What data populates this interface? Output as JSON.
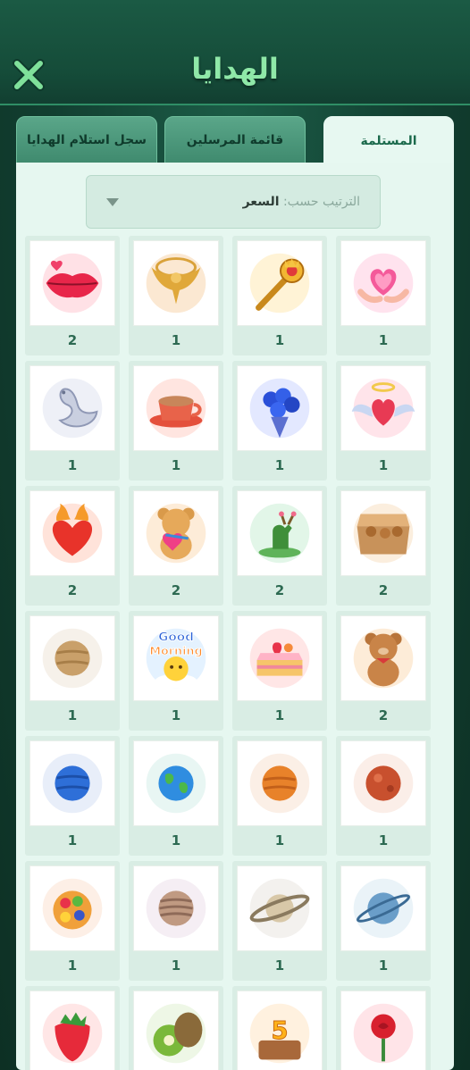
{
  "header": {
    "title": "الهدايا",
    "close_icon": "close-icon"
  },
  "tabs": [
    {
      "label": "المستلمة",
      "active": true
    },
    {
      "label": "قائمة المرسلين",
      "active": false
    },
    {
      "label": "سجل استلام الهدايا",
      "active": false
    }
  ],
  "sort": {
    "prefix": "الترتيب حسب:",
    "value": "السعر"
  },
  "gifts": [
    {
      "icon": "heart-hands-gift-icon",
      "count": "1"
    },
    {
      "icon": "royal-scepter-gift-icon",
      "count": "1"
    },
    {
      "icon": "golden-eagle-gift-icon",
      "count": "1"
    },
    {
      "icon": "red-lips-gift-icon",
      "count": "2"
    },
    {
      "icon": "winged-heart-gift-icon",
      "count": "1"
    },
    {
      "icon": "blue-rose-bouquet-gift-icon",
      "count": "1"
    },
    {
      "icon": "coffee-cup-gift-icon",
      "count": "1"
    },
    {
      "icon": "crystal-swan-gift-icon",
      "count": "1"
    },
    {
      "icon": "cookie-box-gift-icon",
      "count": "2"
    },
    {
      "icon": "flower-deer-gift-icon",
      "count": "2"
    },
    {
      "icon": "teddy-bear-heart-gift-icon",
      "count": "2"
    },
    {
      "icon": "fire-heart-gift-icon",
      "count": "2"
    },
    {
      "icon": "teddy-bear-gift-icon",
      "count": "2"
    },
    {
      "icon": "strawberry-cake-gift-icon",
      "count": "1"
    },
    {
      "icon": "good-morning-sun-gift-icon",
      "count": "1"
    },
    {
      "icon": "tan-planet-gift-icon",
      "count": "1"
    },
    {
      "icon": "mars-planet-gift-icon",
      "count": "1"
    },
    {
      "icon": "orange-planet-gift-icon",
      "count": "1"
    },
    {
      "icon": "earth-planet-gift-icon",
      "count": "1"
    },
    {
      "icon": "blue-planet-gift-icon",
      "count": "1"
    },
    {
      "icon": "uranus-planet-gift-icon",
      "count": "1"
    },
    {
      "icon": "saturn-planet-gift-icon",
      "count": "1"
    },
    {
      "icon": "jupiter-planet-gift-icon",
      "count": "1"
    },
    {
      "icon": "fruit-bowl-gift-icon",
      "count": "1"
    },
    {
      "icon": "red-rose-gift-icon",
      "count": ""
    },
    {
      "icon": "birthday-cake-5-gift-icon",
      "count": ""
    },
    {
      "icon": "kiwi-gift-icon",
      "count": ""
    },
    {
      "icon": "strawberry-gift-icon",
      "count": ""
    }
  ],
  "good_morning_label": {
    "line1": "Good",
    "line2": "Morning"
  },
  "cake_number": "5",
  "colors": {
    "accent": "#8fe8a8",
    "background": "#123f31",
    "panel": "#e6f7f0",
    "count_text": "#2d6a52"
  }
}
